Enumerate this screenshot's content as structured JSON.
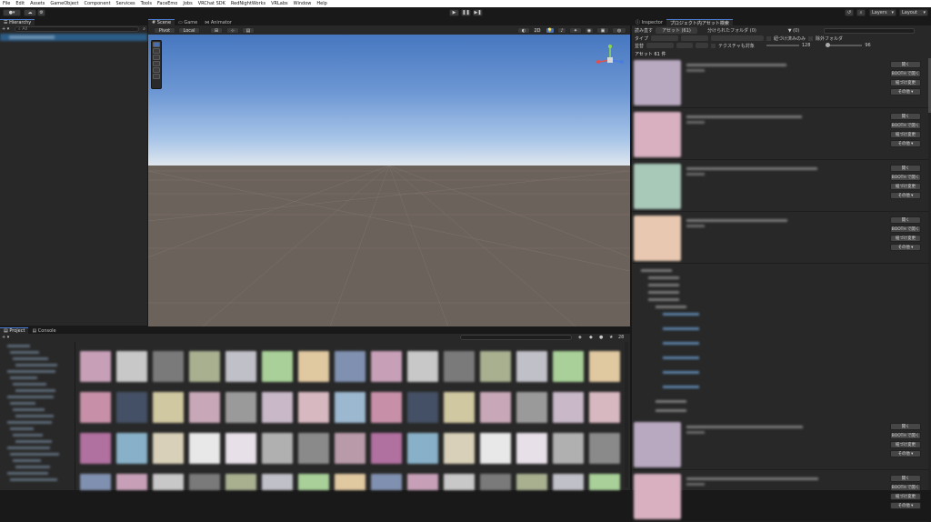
{
  "menu": [
    "File",
    "Edit",
    "Assets",
    "GameObject",
    "Component",
    "Services",
    "Tools",
    "FaceEmo",
    "Jobs",
    "VRChat SDK",
    "RedNightWorks",
    "VRLabs",
    "Window",
    "Help"
  ],
  "toolbar": {
    "play": "▶",
    "pause": "❚❚",
    "step": "▶❚",
    "layers_label": "Layers",
    "layout_label": "Layout",
    "history_icon": "history-icon",
    "search_icon": "search-icon"
  },
  "hierarchy": {
    "tab": "Hierarchy",
    "add": "+ ▾",
    "search_placeholder": "All"
  },
  "scene": {
    "tabs": [
      "Scene",
      "Game",
      "Animator"
    ],
    "pivot": "Pivot",
    "local": "Local",
    "twod": "2D",
    "tools": [
      "hand-tool-icon",
      "move-tool-icon",
      "rotate-tool-icon",
      "scale-tool-icon",
      "rect-tool-icon",
      "transform-tool-icon"
    ]
  },
  "project": {
    "tabs": [
      "Project",
      "Console"
    ],
    "add": "+ ▾",
    "count": "28"
  },
  "inspector": {
    "tabs": [
      "Inspector",
      "プロジェクト内アセット検索"
    ],
    "reload": "読み直す",
    "subtabs": [
      "アセット (61)",
      "分けられたフォルダ (0)",
      "▼ (0)"
    ],
    "filter_label": "タイプ",
    "sort_label": "並替",
    "section_header": "アセット 61 件",
    "checkbox1": "紐づけ済みのみ",
    "checkbox2": "除外フォルダ",
    "checkbox3": "テクスチャも対象",
    "slider1_value": "128",
    "slider2_value": "96",
    "buttons": [
      "開く",
      "BOOTH で開く",
      "紐づけ変更",
      "その他 ▾"
    ],
    "tree_folder": "Assets"
  },
  "colors": {
    "accent": "#4a7bd4",
    "panel": "#282828",
    "dark": "#191919",
    "button": "#464646"
  }
}
